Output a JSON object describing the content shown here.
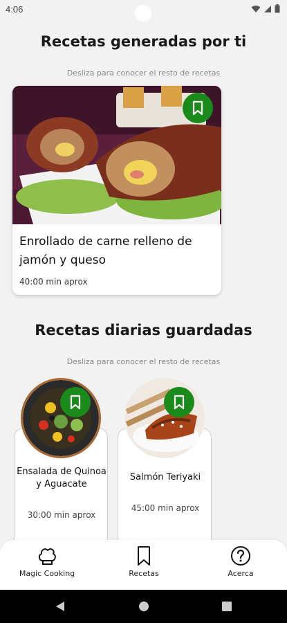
{
  "status_bar": {
    "time": "4:06"
  },
  "generated": {
    "title": "Recetas generadas por ti",
    "hint": "Desliza para conocer el resto de recetas",
    "card": {
      "title": "Enrollado de carne relleno de jamón y queso",
      "time": "40:00 min aprox",
      "bookmark_color": "#1a8a1a"
    }
  },
  "daily": {
    "title": "Recetas diarias guardadas",
    "hint": "Desliza para conocer el resto de recetas",
    "cards": [
      {
        "title": "Ensalada de Quinoa y Aguacate",
        "time": "30:00 min aprox"
      },
      {
        "title": "Salmón Teriyaki",
        "time": "45:00 min aprox"
      }
    ]
  },
  "bottom_nav": {
    "items": [
      {
        "label": "Magic Cooking",
        "icon": "chef-hat-icon"
      },
      {
        "label": "Recetas",
        "icon": "bookmark-icon"
      },
      {
        "label": "Acerca",
        "icon": "help-icon"
      }
    ]
  },
  "colors": {
    "accent": "#1a8a1a",
    "background": "#f2f2f2"
  }
}
